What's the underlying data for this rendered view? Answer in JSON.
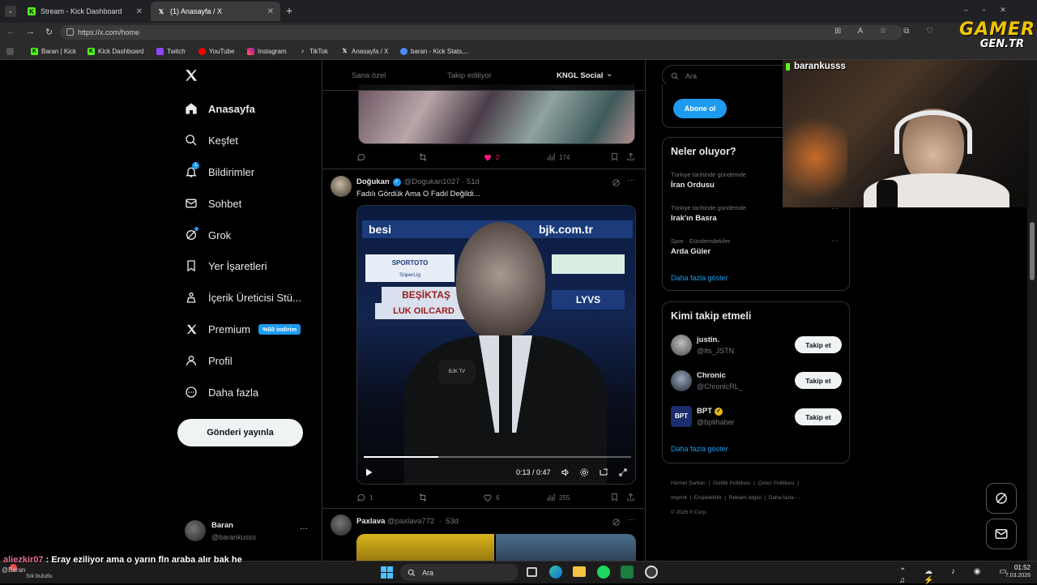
{
  "browser": {
    "tabs": [
      {
        "title": "Stream - Kick Dashboard"
      },
      {
        "title": "(1) Anasayfa / X"
      }
    ],
    "url": "https://x.com/home",
    "bookmarks": [
      "Baran | Kick",
      "Kick Dashboard",
      "Twitch",
      "YouTube",
      "Instagram",
      "TikTok",
      "Anasayfa / X",
      "baran - Kick Stats,..."
    ]
  },
  "watermark": {
    "line1": "GAMER",
    "line2": "GEN.TR"
  },
  "sidebar": {
    "items": [
      {
        "label": "Anasayfa",
        "icon": "home-icon"
      },
      {
        "label": "Keşfet",
        "icon": "search-icon"
      },
      {
        "label": "Bildirimler",
        "icon": "bell-icon",
        "badge": "1"
      },
      {
        "label": "Sohbet",
        "icon": "mail-icon"
      },
      {
        "label": "Grok",
        "icon": "grok-icon"
      },
      {
        "label": "Yer İşaretleri",
        "icon": "bookmark-icon"
      },
      {
        "label": "İçerik Üreticisi Stü...",
        "icon": "creator-icon"
      },
      {
        "label": "Premium",
        "icon": "x-logo-icon",
        "badge": "%50 indirim"
      },
      {
        "label": "Profil",
        "icon": "profile-icon"
      },
      {
        "label": "Daha fazla",
        "icon": "more-circle-icon"
      }
    ],
    "post_button": "Gönderi yayınla",
    "account": {
      "name": "Baran",
      "handle": "@barankusss"
    }
  },
  "feed": {
    "tabs": [
      "Sana özel",
      "Takip ediliyor",
      "KNGL Social"
    ],
    "first_tweet_actions": {
      "replies": "",
      "retweets": "",
      "likes": "2",
      "views": "174"
    },
    "tweet": {
      "name": "Doğukan",
      "handle": "@Dogukan1027",
      "time": "51d",
      "text": "Fadılı Gördük Ama O Fadıl Değildi...",
      "video": {
        "time": "0:13 / 0:47",
        "progress": 0.28,
        "banner_top": "besi",
        "banner_site": "bjk.com.tr",
        "sponsor": "SPORTOTO",
        "league": "SüperLig",
        "club": "BEŞİKTAŞ",
        "card": "LUK OILCARD",
        "brand": "LYVS",
        "mic": "BJK TV"
      },
      "actions": {
        "replies": "1",
        "retweets": "",
        "likes": "6",
        "views": "255"
      }
    },
    "next_tweet": {
      "name": "Paxlava",
      "handle": "@paxlava772",
      "time": "53d"
    }
  },
  "right": {
    "search_placeholder": "Ara",
    "subscribe_label": "Abone ol",
    "trends_title": "Neler oluyor?",
    "trends": [
      {
        "context": "Türkiye tarihinde gündemde",
        "name": "İran Ordusu"
      },
      {
        "context": "Türkiye tarihinde gündemde",
        "name": "Irak'ın Basra"
      },
      {
        "context": "Spor · Gündemdekiler",
        "name": "Arda Güler"
      }
    ],
    "trends_more": "Daha fazla göster",
    "who_title": "Kimi takip etmeli",
    "who": [
      {
        "name": "justin.",
        "handle": "@Its_JSTN",
        "button": "Takip et"
      },
      {
        "name": "Chronic",
        "handle": "@ChronicRL_",
        "button": "Takip et"
      },
      {
        "name": "BPT",
        "handle": "@bptihaber",
        "button": "Takip et",
        "verified": true
      }
    ],
    "who_more": "Daha fazla göster",
    "footer": [
      "Hizmet Şartları",
      "Gizlilik Politikası",
      "Çerez Politikası",
      "Imprint",
      "Erişilebilirlik",
      "Reklam bilgisi",
      "Daha fazla ···",
      "© 2026 X Corp."
    ]
  },
  "webcam": {
    "username": "barankusss"
  },
  "chat_overlay": {
    "user": "aliezkir07",
    "message": "Eray eziliyor ama o yarın fln araba alır bak he",
    "bottom_left": "@Baran",
    "bottom_note": "Sık bulutlu"
  },
  "taskbar": {
    "search": "Ara",
    "time": "01:52",
    "date": "7.03.2026"
  }
}
